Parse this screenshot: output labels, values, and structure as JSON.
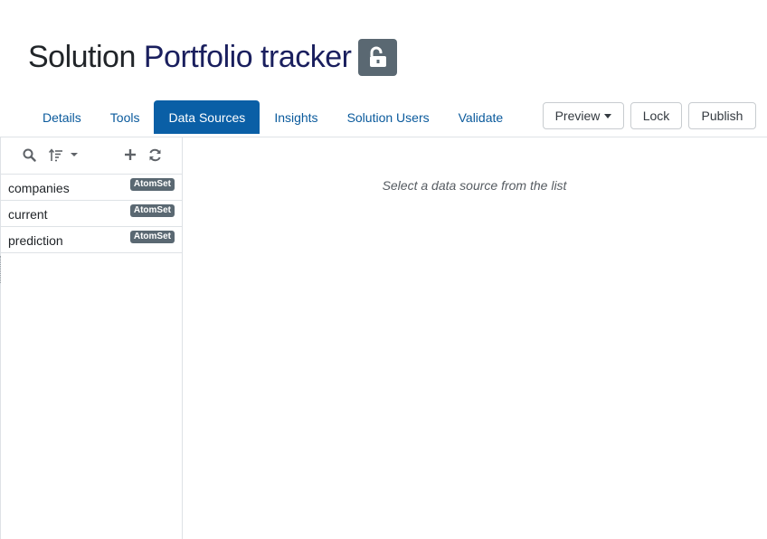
{
  "header": {
    "title_prefix": "Solution",
    "title_name": "Portfolio tracker",
    "lock_icon": "unlocked-padlock-icon"
  },
  "tabs": [
    {
      "label": "Details",
      "active": false
    },
    {
      "label": "Tools",
      "active": false
    },
    {
      "label": "Data Sources",
      "active": true
    },
    {
      "label": "Insights",
      "active": false
    },
    {
      "label": "Solution Users",
      "active": false
    },
    {
      "label": "Validate",
      "active": false
    }
  ],
  "actions": {
    "preview_label": "Preview",
    "lock_label": "Lock",
    "publish_label": "Publish"
  },
  "sidebar": {
    "toolbar_icons": [
      "search-icon",
      "sort-icon",
      "plus-icon",
      "refresh-icon"
    ],
    "items": [
      {
        "name": "companies",
        "badge": "AtomSet"
      },
      {
        "name": "current",
        "badge": "AtomSet"
      },
      {
        "name": "prediction",
        "badge": "AtomSet"
      }
    ]
  },
  "main": {
    "empty_message": "Select a data source from the list"
  },
  "colors": {
    "accent": "#0a5fa6",
    "badge": "#5a6872",
    "title_dark": "#212529",
    "title_name": "#1a1f5e"
  }
}
